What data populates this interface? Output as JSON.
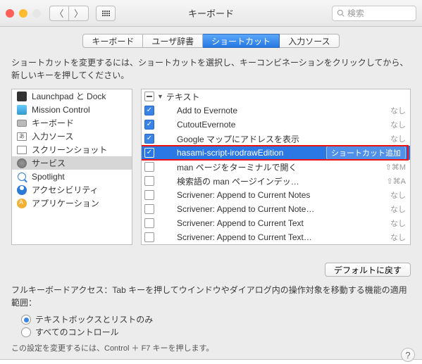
{
  "window": {
    "title": "キーボード",
    "search_placeholder": "検索"
  },
  "tabs": {
    "items": [
      "キーボード",
      "ユーザ辞書",
      "ショートカット",
      "入力ソース"
    ],
    "selected_index": 2
  },
  "description": "ショートカットを変更するには、ショートカットを選択し、キーコンビネーションをクリックしてから、新しいキーを押してください。",
  "sidebar": {
    "items": [
      {
        "label": "Launchpad と Dock",
        "icon": "launchpad"
      },
      {
        "label": "Mission Control",
        "icon": "mission"
      },
      {
        "label": "キーボード",
        "icon": "keyboard"
      },
      {
        "label": "入力ソース",
        "icon": "input"
      },
      {
        "label": "スクリーンショット",
        "icon": "screenshot"
      },
      {
        "label": "サービス",
        "icon": "service",
        "selected": true
      },
      {
        "label": "Spotlight",
        "icon": "spotlight"
      },
      {
        "label": "アクセシビリティ",
        "icon": "accessibility"
      },
      {
        "label": "アプリケーション",
        "icon": "app"
      }
    ]
  },
  "shortcuts": {
    "group_label": "テキスト",
    "items": [
      {
        "checked": true,
        "label": "Add to Evernote",
        "shortcut": "なし"
      },
      {
        "checked": true,
        "label": "CutoutEvernote",
        "shortcut": "なし"
      },
      {
        "checked": true,
        "label": "Google マップにアドレスを表示",
        "shortcut": "なし"
      },
      {
        "checked": true,
        "label": "hasami-script-irodrawEdition",
        "shortcut_button": "ショートカット追加",
        "selected": true
      },
      {
        "checked": false,
        "label": "man ページをターミナルで開く",
        "shortcut": "⇧⌘M"
      },
      {
        "checked": false,
        "label": "検索語の man ページインデッ…",
        "shortcut": "⇧⌘A"
      },
      {
        "checked": false,
        "label": "Scrivener: Append to Current Notes",
        "shortcut": "なし"
      },
      {
        "checked": false,
        "label": "Scrivener: Append to Current Note…",
        "shortcut": "なし"
      },
      {
        "checked": false,
        "label": "Scrivener: Append to Current Text",
        "shortcut": "なし"
      },
      {
        "checked": false,
        "label": "Scrivener: Append to Current Text…",
        "shortcut": "なし"
      }
    ]
  },
  "defaults_button": "デフォルトに戻す",
  "fka": {
    "description": "フルキーボードアクセス：Tab キーを押してウインドウやダイアログ内の操作対象を移動する機能の適用範囲：",
    "option1": "テキストボックスとリストのみ",
    "option2": "すべてのコントロール",
    "hint": "この設定を変更するには、Control ＋ F7 キーを押します。"
  }
}
